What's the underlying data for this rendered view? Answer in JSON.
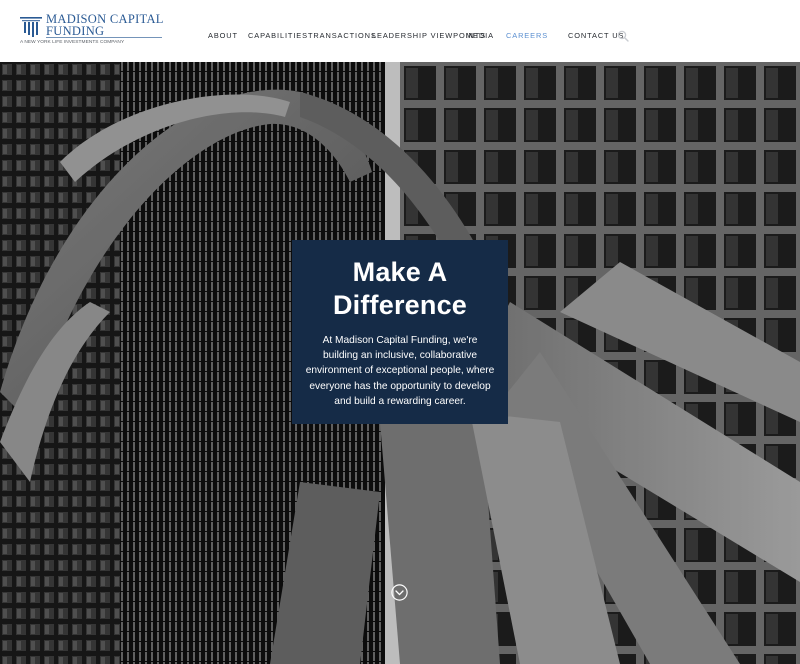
{
  "brand": {
    "name_line1": "MADISON CAPITAL",
    "name_line2": "FUNDING",
    "tagline": "A NEW YORK LIFE INVESTMENTS COMPANY",
    "color": "#2a5a94"
  },
  "nav": {
    "items": [
      {
        "label": "ABOUT"
      },
      {
        "label": "CAPABILITIES"
      },
      {
        "label": "TRANSACTIONS"
      },
      {
        "label": "LEADERSHIP VIEWPOINTS"
      },
      {
        "label": "MEDIA"
      },
      {
        "label": "CAREERS",
        "active": true
      },
      {
        "label": "CONTACT US"
      }
    ],
    "active_color": "#5b8fd0",
    "search_icon": "search-icon"
  },
  "hero": {
    "title_line1": "Make A",
    "title_line2": "Difference",
    "body": "At Madison Capital Funding, we're building an inclusive, collaborative environment of exceptional people, where everyone has the opportunity to develop and build a rewarding career.",
    "callout_color": "#152b47",
    "scroll_icon": "chevron-down-circle-icon"
  }
}
